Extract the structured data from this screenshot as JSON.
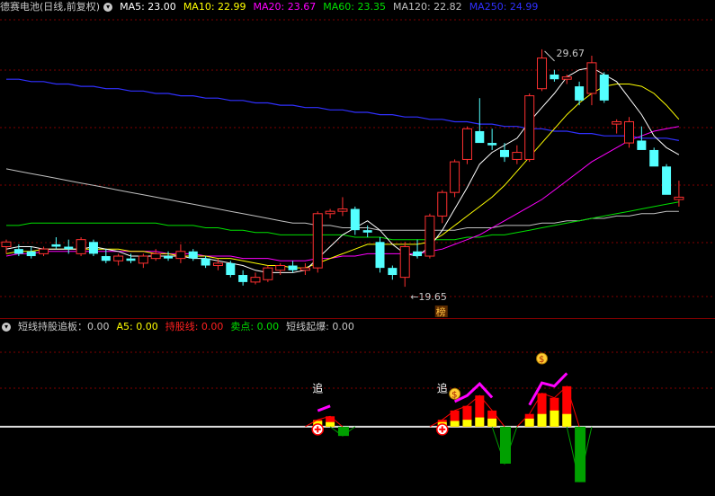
{
  "stock_title": "德赛电池(日线,前复权)",
  "ma_legend": [
    {
      "label": "MA5: 23.00",
      "color": "#ffffff"
    },
    {
      "label": "MA10: 22.99",
      "color": "#ffff00"
    },
    {
      "label": "MA20: 23.67",
      "color": "#ff00ff"
    },
    {
      "label": "MA60: 23.35",
      "color": "#00e000"
    },
    {
      "label": "MA120: 22.82",
      "color": "#c0c0c0"
    },
    {
      "label": "MA250: 24.99",
      "color": "#3030ff"
    }
  ],
  "indicator_legend": [
    {
      "label": "短线持股追板：0.00",
      "color": "#c8c8c8"
    },
    {
      "label": "A5: 0.00",
      "color": "#ffff00"
    },
    {
      "label": "持股线: 0.00",
      "color": "#ff2020"
    },
    {
      "label": "卖点: 0.00",
      "color": "#00e000"
    },
    {
      "label": "短线起爆: 0.00",
      "color": "#c8c8c8"
    }
  ],
  "colors": {
    "up": "#ff3030",
    "down": "#54ffff",
    "ma5": "#ffffff",
    "ma10": "#ffff00",
    "ma20": "#ff00ff",
    "ma60": "#00e000",
    "ma120": "#c0c0c0",
    "ma250": "#3030ff",
    "grid": "#800000",
    "bar_red": "#ff0000",
    "bar_yellow": "#ffff00",
    "bar_green": "#00a000",
    "chase_line": "#ff00ff"
  },
  "chart_data": [
    {
      "type": "candlestick",
      "price_range": [
        18.5,
        31.0
      ],
      "high_label": "29.67",
      "low_label": "19.65",
      "badge": "榜",
      "candles": [
        {
          "o": 21.3,
          "h": 21.6,
          "l": 21.0,
          "c": 21.5
        },
        {
          "o": 21.2,
          "h": 21.4,
          "l": 20.9,
          "c": 21.0
        },
        {
          "o": 21.1,
          "h": 21.3,
          "l": 20.8,
          "c": 20.9
        },
        {
          "o": 21.0,
          "h": 21.3,
          "l": 20.9,
          "c": 21.2
        },
        {
          "o": 21.4,
          "h": 21.7,
          "l": 21.2,
          "c": 21.3
        },
        {
          "o": 21.3,
          "h": 21.6,
          "l": 21.0,
          "c": 21.2
        },
        {
          "o": 21.0,
          "h": 21.7,
          "l": 20.9,
          "c": 21.6
        },
        {
          "o": 21.5,
          "h": 21.6,
          "l": 20.9,
          "c": 21.0
        },
        {
          "o": 20.9,
          "h": 21.2,
          "l": 20.6,
          "c": 20.7
        },
        {
          "o": 20.7,
          "h": 21.0,
          "l": 20.5,
          "c": 20.9
        },
        {
          "o": 20.8,
          "h": 21.0,
          "l": 20.6,
          "c": 20.7
        },
        {
          "o": 20.6,
          "h": 21.0,
          "l": 20.4,
          "c": 20.9
        },
        {
          "o": 20.8,
          "h": 21.2,
          "l": 20.7,
          "c": 21.0
        },
        {
          "o": 20.9,
          "h": 21.1,
          "l": 20.7,
          "c": 20.8
        },
        {
          "o": 20.8,
          "h": 21.4,
          "l": 20.6,
          "c": 21.1
        },
        {
          "o": 21.1,
          "h": 21.2,
          "l": 20.7,
          "c": 20.8
        },
        {
          "o": 20.8,
          "h": 20.9,
          "l": 20.4,
          "c": 20.5
        },
        {
          "o": 20.5,
          "h": 20.8,
          "l": 20.3,
          "c": 20.6
        },
        {
          "o": 20.6,
          "h": 20.7,
          "l": 20.0,
          "c": 20.1
        },
        {
          "o": 20.1,
          "h": 20.3,
          "l": 19.65,
          "c": 19.8
        },
        {
          "o": 19.8,
          "h": 20.2,
          "l": 19.7,
          "c": 20.0
        },
        {
          "o": 19.9,
          "h": 20.5,
          "l": 19.8,
          "c": 20.4
        },
        {
          "o": 20.3,
          "h": 20.6,
          "l": 20.1,
          "c": 20.5
        },
        {
          "o": 20.5,
          "h": 20.7,
          "l": 20.2,
          "c": 20.3
        },
        {
          "o": 20.3,
          "h": 20.6,
          "l": 20.1,
          "c": 20.4
        },
        {
          "o": 20.4,
          "h": 22.8,
          "l": 20.2,
          "c": 22.7
        },
        {
          "o": 22.7,
          "h": 22.9,
          "l": 22.5,
          "c": 22.8
        },
        {
          "o": 22.8,
          "h": 23.4,
          "l": 22.6,
          "c": 22.9
        },
        {
          "o": 22.9,
          "h": 23.0,
          "l": 21.8,
          "c": 22.0
        },
        {
          "o": 22.0,
          "h": 22.2,
          "l": 21.7,
          "c": 21.9
        },
        {
          "o": 21.5,
          "h": 21.7,
          "l": 20.2,
          "c": 20.4
        },
        {
          "o": 20.4,
          "h": 20.5,
          "l": 19.9,
          "c": 20.1
        },
        {
          "o": 20.0,
          "h": 21.5,
          "l": 19.6,
          "c": 21.3
        },
        {
          "o": 21.1,
          "h": 21.6,
          "l": 20.8,
          "c": 20.9
        },
        {
          "o": 20.9,
          "h": 22.7,
          "l": 20.8,
          "c": 22.6
        },
        {
          "o": 22.6,
          "h": 23.7,
          "l": 22.3,
          "c": 23.6
        },
        {
          "o": 23.6,
          "h": 25.0,
          "l": 23.4,
          "c": 24.9
        },
        {
          "o": 25.0,
          "h": 26.4,
          "l": 24.8,
          "c": 26.3
        },
        {
          "o": 26.2,
          "h": 27.6,
          "l": 25.8,
          "c": 25.7
        },
        {
          "o": 25.7,
          "h": 26.3,
          "l": 25.4,
          "c": 25.6
        },
        {
          "o": 25.4,
          "h": 25.7,
          "l": 24.9,
          "c": 25.1
        },
        {
          "o": 25.0,
          "h": 25.6,
          "l": 24.8,
          "c": 25.3
        },
        {
          "o": 25.0,
          "h": 27.8,
          "l": 24.9,
          "c": 27.7
        },
        {
          "o": 28.0,
          "h": 29.67,
          "l": 27.9,
          "c": 29.3
        },
        {
          "o": 28.6,
          "h": 28.8,
          "l": 28.3,
          "c": 28.4
        },
        {
          "o": 28.4,
          "h": 28.6,
          "l": 28.2,
          "c": 28.5
        },
        {
          "o": 28.1,
          "h": 28.3,
          "l": 27.3,
          "c": 27.5
        },
        {
          "o": 27.8,
          "h": 29.4,
          "l": 27.3,
          "c": 29.1
        },
        {
          "o": 28.6,
          "h": 28.7,
          "l": 27.4,
          "c": 27.5
        },
        {
          "o": 26.5,
          "h": 26.7,
          "l": 26.1,
          "c": 26.6
        },
        {
          "o": 25.7,
          "h": 26.8,
          "l": 25.5,
          "c": 26.6
        },
        {
          "o": 25.8,
          "h": 26.4,
          "l": 25.5,
          "c": 25.4
        },
        {
          "o": 25.4,
          "h": 25.5,
          "l": 24.8,
          "c": 24.7
        },
        {
          "o": 24.7,
          "h": 24.8,
          "l": 23.6,
          "c": 23.5
        },
        {
          "o": 23.3,
          "h": 24.1,
          "l": 23.0,
          "c": 23.4
        }
      ],
      "ma_lines": {
        "ma5": [
          21.2,
          21.3,
          21.3,
          21.2,
          21.2,
          21.2,
          21.2,
          21.3,
          21.2,
          21.1,
          20.9,
          20.9,
          20.9,
          20.9,
          20.9,
          20.8,
          20.8,
          20.7,
          20.6,
          20.5,
          20.3,
          20.2,
          20.2,
          20.2,
          20.3,
          20.8,
          21.3,
          21.8,
          22.1,
          22.4,
          22.0,
          21.4,
          21.0,
          20.9,
          21.3,
          22.0,
          22.9,
          23.8,
          24.8,
          25.3,
          25.6,
          25.9,
          26.6,
          27.2,
          27.8,
          28.5,
          28.8,
          28.9,
          28.6,
          28.3,
          27.6,
          26.9,
          26.0,
          25.5,
          25.2
        ],
        "ma10": [
          21.0,
          21.1,
          21.1,
          21.2,
          21.2,
          21.2,
          21.2,
          21.2,
          21.2,
          21.2,
          21.1,
          21.1,
          21.0,
          21.0,
          20.9,
          20.9,
          20.9,
          20.8,
          20.8,
          20.7,
          20.6,
          20.5,
          20.5,
          20.4,
          20.4,
          20.6,
          20.8,
          21.0,
          21.2,
          21.4,
          21.4,
          21.4,
          21.4,
          21.4,
          21.5,
          21.8,
          22.2,
          22.6,
          23.0,
          23.4,
          23.9,
          24.5,
          25.1,
          25.7,
          26.3,
          26.9,
          27.4,
          27.8,
          28.1,
          28.2,
          28.2,
          28.1,
          27.8,
          27.3,
          26.7
        ],
        "ma20": [
          20.9,
          21.0,
          21.0,
          21.1,
          21.1,
          21.1,
          21.1,
          21.1,
          21.1,
          21.1,
          21.1,
          21.1,
          21.1,
          21.0,
          21.0,
          21.0,
          20.9,
          20.9,
          20.9,
          20.8,
          20.8,
          20.8,
          20.7,
          20.7,
          20.7,
          20.8,
          20.8,
          20.9,
          20.9,
          21.0,
          21.0,
          21.0,
          21.0,
          21.0,
          21.1,
          21.2,
          21.4,
          21.6,
          21.8,
          22.1,
          22.4,
          22.7,
          23.0,
          23.3,
          23.7,
          24.1,
          24.5,
          24.9,
          25.2,
          25.5,
          25.8,
          26.0,
          26.2,
          26.3,
          26.4
        ],
        "ma60": [
          22.2,
          22.2,
          22.3,
          22.3,
          22.3,
          22.3,
          22.3,
          22.3,
          22.3,
          22.3,
          22.3,
          22.3,
          22.3,
          22.2,
          22.2,
          22.2,
          22.1,
          22.1,
          22.0,
          22.0,
          21.9,
          21.9,
          21.8,
          21.8,
          21.8,
          21.8,
          21.8,
          21.8,
          21.7,
          21.7,
          21.7,
          21.6,
          21.6,
          21.6,
          21.6,
          21.6,
          21.6,
          21.7,
          21.7,
          21.8,
          21.8,
          21.9,
          22.0,
          22.1,
          22.2,
          22.3,
          22.4,
          22.5,
          22.6,
          22.7,
          22.8,
          22.9,
          23.0,
          23.1,
          23.2
        ],
        "ma120": [
          24.6,
          24.5,
          24.4,
          24.3,
          24.2,
          24.1,
          24.0,
          23.9,
          23.8,
          23.7,
          23.6,
          23.5,
          23.4,
          23.3,
          23.2,
          23.1,
          23.0,
          22.9,
          22.8,
          22.7,
          22.6,
          22.5,
          22.4,
          22.3,
          22.3,
          22.2,
          22.2,
          22.1,
          22.1,
          22.1,
          22.0,
          22.0,
          22.0,
          22.0,
          22.0,
          22.0,
          22.0,
          22.1,
          22.1,
          22.1,
          22.2,
          22.2,
          22.2,
          22.3,
          22.3,
          22.4,
          22.4,
          22.5,
          22.5,
          22.6,
          22.6,
          22.7,
          22.7,
          22.8,
          22.8
        ],
        "ma250": [
          28.4,
          28.4,
          28.3,
          28.3,
          28.2,
          28.2,
          28.1,
          28.1,
          28.0,
          28.0,
          27.9,
          27.9,
          27.8,
          27.8,
          27.7,
          27.7,
          27.6,
          27.6,
          27.5,
          27.5,
          27.4,
          27.4,
          27.3,
          27.3,
          27.2,
          27.2,
          27.1,
          27.1,
          27.0,
          27.0,
          26.9,
          26.9,
          26.8,
          26.8,
          26.7,
          26.7,
          26.6,
          26.6,
          26.5,
          26.5,
          26.4,
          26.4,
          26.3,
          26.3,
          26.2,
          26.2,
          26.1,
          26.1,
          26.0,
          26.0,
          26.0,
          25.9,
          25.9,
          25.9,
          25.8
        ]
      }
    },
    {
      "type": "bar",
      "value_range": [
        -6,
        8
      ],
      "bars": [
        {
          "i": 25,
          "red": 0.6,
          "yellow": 0.5
        },
        {
          "i": 26,
          "red": 0.9,
          "yellow": 0.4
        },
        {
          "i": 27,
          "green": -0.8
        },
        {
          "i": 35,
          "red": 0.6,
          "yellow": 0.4
        },
        {
          "i": 36,
          "red": 1.4,
          "yellow": 0.5
        },
        {
          "i": 37,
          "red": 1.8,
          "yellow": 0.6
        },
        {
          "i": 38,
          "red": 2.7,
          "yellow": 0.8
        },
        {
          "i": 39,
          "red": 1.4,
          "yellow": 0.7
        },
        {
          "i": 40,
          "green": -3.2
        },
        {
          "i": 42,
          "red": 1.1,
          "yellow": 0.7
        },
        {
          "i": 43,
          "red": 2.9,
          "yellow": 1.1
        },
        {
          "i": 44,
          "red": 2.5,
          "yellow": 1.4
        },
        {
          "i": 45,
          "red": 3.5,
          "yellow": 1.1
        },
        {
          "i": 46,
          "green": -4.8
        }
      ],
      "chase_segments": [
        [
          25,
          26
        ],
        [
          36,
          39
        ],
        [
          42,
          45
        ]
      ],
      "chase_labels": [
        {
          "i": 25,
          "text": "追"
        },
        {
          "i": 35,
          "text": "追"
        }
      ],
      "buy_markers": [
        25,
        35
      ],
      "money_markers": [
        36,
        43
      ]
    }
  ]
}
